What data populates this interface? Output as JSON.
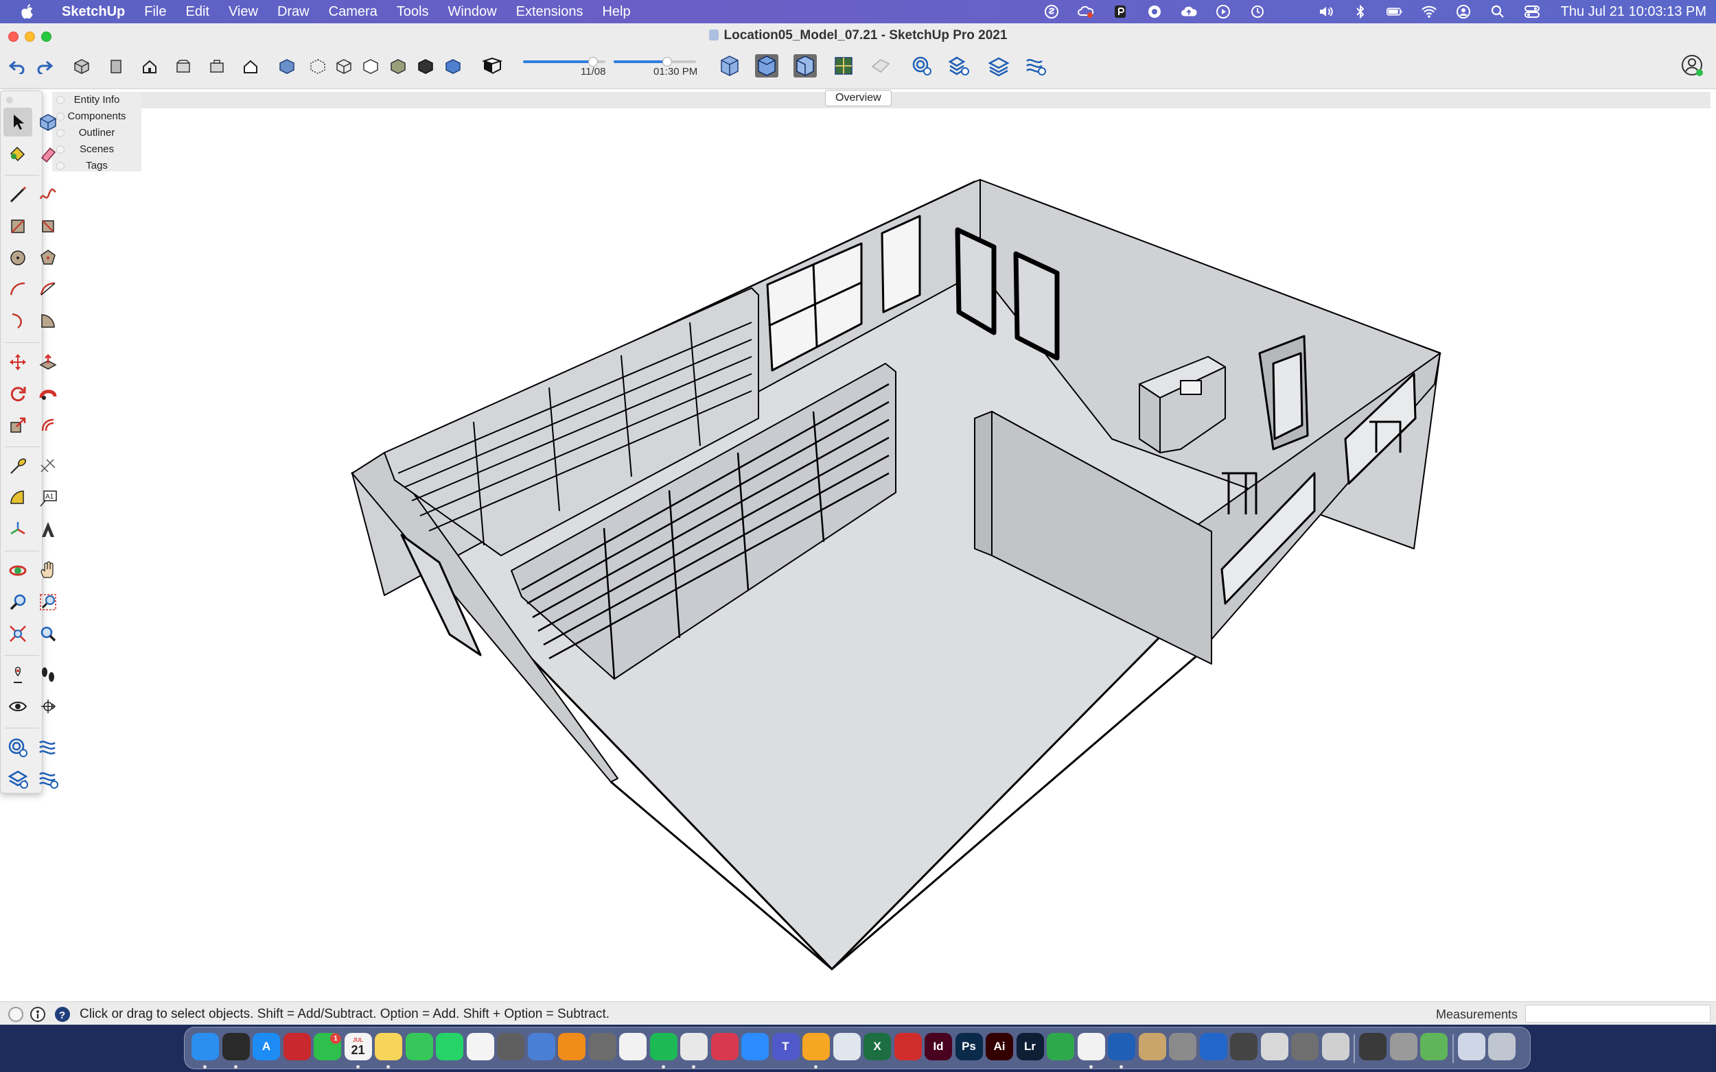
{
  "menubar": {
    "app_name": "SketchUp",
    "items": [
      "File",
      "Edit",
      "View",
      "Draw",
      "Camera",
      "Tools",
      "Window",
      "Extensions",
      "Help"
    ],
    "clock": "Thu Jul 21  10:03:13 PM"
  },
  "window": {
    "title": "Location05_Model_07.21 - SketchUp Pro 2021"
  },
  "toolbar": {
    "shadow_date": "11/08",
    "shadow_time": "01:30 PM",
    "date_slider_fraction": 0.85,
    "time_slider_fraction": 0.65
  },
  "scenes": {
    "active_tab": "Overview"
  },
  "tray": {
    "items": [
      "Entity Info",
      "Components",
      "Outliner",
      "Scenes",
      "Tags"
    ]
  },
  "statusbar": {
    "hint": "Click or drag to select objects. Shift = Add/Subtract. Option = Add. Shift + Option = Subtract.",
    "measurements_label": "Measurements",
    "measurements_value": ""
  },
  "dock": {
    "calendar_month": "JUL",
    "calendar_day": "21",
    "messages_badge": "1",
    "items": [
      {
        "name": "Finder",
        "label": "",
        "color": "#2b8ff0"
      },
      {
        "name": "Activity Monitor",
        "label": "",
        "color": "#2a2a2a"
      },
      {
        "name": "App Store",
        "label": "A",
        "color": "#1d8cf5"
      },
      {
        "name": "Photo Booth",
        "label": "",
        "color": "#c8282e"
      },
      {
        "name": "FaceTime",
        "label": "",
        "color": "#2fbf4c"
      },
      {
        "name": "Calendar",
        "label": "21",
        "color": "#f4f4f4"
      },
      {
        "name": "Notes",
        "label": "",
        "color": "#f7d45a"
      },
      {
        "name": "Messages",
        "label": "",
        "color": "#35c759"
      },
      {
        "name": "WhatsApp",
        "label": "",
        "color": "#25d366"
      },
      {
        "name": "Reminders",
        "label": "",
        "color": "#f4f4f4"
      },
      {
        "name": "Calculator",
        "label": "",
        "color": "#5f5f5f"
      },
      {
        "name": "Preview",
        "label": "",
        "color": "#4a7fd6"
      },
      {
        "name": "VLC",
        "label": "",
        "color": "#f08c1a"
      },
      {
        "name": "Image Capture",
        "label": "",
        "color": "#6c6c6c"
      },
      {
        "name": "Photos",
        "label": "",
        "color": "#f2f2f2"
      },
      {
        "name": "Spotify",
        "label": "",
        "color": "#1db954"
      },
      {
        "name": "Chrome",
        "label": "",
        "color": "#e8e8e8"
      },
      {
        "name": "Creative Cloud",
        "label": "",
        "color": "#d9394f"
      },
      {
        "name": "Zoom",
        "label": "",
        "color": "#2d8cff"
      },
      {
        "name": "Teams",
        "label": "T",
        "color": "#5059c9"
      },
      {
        "name": "Sketch",
        "label": "",
        "color": "#f6a623"
      },
      {
        "name": "SketchUp Layout",
        "label": "",
        "color": "#dfe6ee"
      },
      {
        "name": "Excel",
        "label": "X",
        "color": "#1d6f42"
      },
      {
        "name": "Acrobat",
        "label": "",
        "color": "#d12c2c"
      },
      {
        "name": "InDesign",
        "label": "Id",
        "color": "#49021f"
      },
      {
        "name": "Photoshop",
        "label": "Ps",
        "color": "#0a2a4a"
      },
      {
        "name": "Illustrator",
        "label": "Ai",
        "color": "#330000"
      },
      {
        "name": "Lightroom",
        "label": "Lr",
        "color": "#0d1e35"
      },
      {
        "name": "Numbers",
        "label": "",
        "color": "#2ea84b"
      },
      {
        "name": "SketchUp",
        "label": "",
        "color": "#f2f2f2"
      },
      {
        "name": "Layers",
        "label": "",
        "color": "#1f5fb6"
      },
      {
        "name": "Keychain",
        "label": "",
        "color": "#c9a46b"
      },
      {
        "name": "Font Book",
        "label": "",
        "color": "#8a8a8a"
      },
      {
        "name": "Script Editor",
        "label": "",
        "color": "#2266c9"
      },
      {
        "name": "Printer",
        "label": "",
        "color": "#444444"
      },
      {
        "name": "Storage",
        "label": "",
        "color": "#d8d8d8"
      },
      {
        "name": "System Preferences",
        "label": "",
        "color": "#6f6f6f"
      },
      {
        "name": "Migration Assistant",
        "label": "",
        "color": "#d0d0d0"
      },
      {
        "name": "QuickTime",
        "label": "",
        "color": "#3a3a3a"
      },
      {
        "name": "Screenshot",
        "label": "",
        "color": "#9a9a9a"
      },
      {
        "name": "Maps",
        "label": "",
        "color": "#60b45a"
      },
      {
        "name": "Downloads",
        "label": "",
        "color": "#cfd7e6"
      },
      {
        "name": "Trash",
        "label": "",
        "color": "#bfc6cf"
      }
    ]
  },
  "colors": {
    "menubar": "#5a62c4",
    "chrome": "#ececec",
    "accent": "#2f7de0",
    "model_face": "#dcdde0",
    "model_edge": "#000000"
  }
}
